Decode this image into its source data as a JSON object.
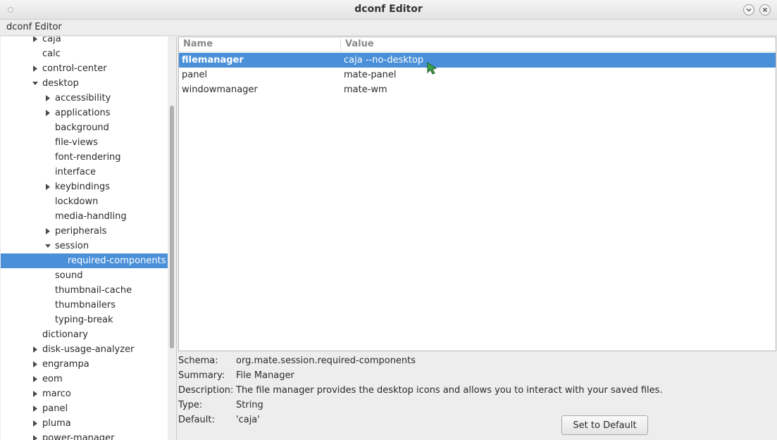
{
  "window": {
    "title": "dconf Editor"
  },
  "menubar": {
    "label": "dconf Editor"
  },
  "tree": {
    "rows": [
      {
        "label": "caja",
        "expander": "collapsed",
        "depth": 0,
        "selected": false
      },
      {
        "label": "calc",
        "expander": "none",
        "depth": 0,
        "selected": false
      },
      {
        "label": "control-center",
        "expander": "collapsed",
        "depth": 0,
        "selected": false
      },
      {
        "label": "desktop",
        "expander": "expanded",
        "depth": 0,
        "selected": false
      },
      {
        "label": "accessibility",
        "expander": "collapsed",
        "depth": 1,
        "selected": false
      },
      {
        "label": "applications",
        "expander": "collapsed",
        "depth": 1,
        "selected": false
      },
      {
        "label": "background",
        "expander": "none",
        "depth": 1,
        "selected": false
      },
      {
        "label": "file-views",
        "expander": "none",
        "depth": 1,
        "selected": false
      },
      {
        "label": "font-rendering",
        "expander": "none",
        "depth": 1,
        "selected": false
      },
      {
        "label": "interface",
        "expander": "none",
        "depth": 1,
        "selected": false
      },
      {
        "label": "keybindings",
        "expander": "collapsed",
        "depth": 1,
        "selected": false
      },
      {
        "label": "lockdown",
        "expander": "none",
        "depth": 1,
        "selected": false
      },
      {
        "label": "media-handling",
        "expander": "none",
        "depth": 1,
        "selected": false
      },
      {
        "label": "peripherals",
        "expander": "collapsed",
        "depth": 1,
        "selected": false
      },
      {
        "label": "session",
        "expander": "expanded",
        "depth": 1,
        "selected": false
      },
      {
        "label": "required-components",
        "expander": "none",
        "depth": 2,
        "selected": true
      },
      {
        "label": "sound",
        "expander": "none",
        "depth": 1,
        "selected": false
      },
      {
        "label": "thumbnail-cache",
        "expander": "none",
        "depth": 1,
        "selected": false
      },
      {
        "label": "thumbnailers",
        "expander": "none",
        "depth": 1,
        "selected": false
      },
      {
        "label": "typing-break",
        "expander": "none",
        "depth": 1,
        "selected": false
      },
      {
        "label": "dictionary",
        "expander": "none",
        "depth": 0,
        "selected": false
      },
      {
        "label": "disk-usage-analyzer",
        "expander": "collapsed",
        "depth": 0,
        "selected": false
      },
      {
        "label": "engrampa",
        "expander": "collapsed",
        "depth": 0,
        "selected": false
      },
      {
        "label": "eom",
        "expander": "collapsed",
        "depth": 0,
        "selected": false
      },
      {
        "label": "marco",
        "expander": "collapsed",
        "depth": 0,
        "selected": false
      },
      {
        "label": "panel",
        "expander": "collapsed",
        "depth": 0,
        "selected": false
      },
      {
        "label": "pluma",
        "expander": "collapsed",
        "depth": 0,
        "selected": false
      },
      {
        "label": "power-manager",
        "expander": "collapsed",
        "depth": 0,
        "selected": false
      }
    ]
  },
  "list": {
    "columns": {
      "name": "Name",
      "value": "Value"
    },
    "rows": [
      {
        "name": "filemanager",
        "value": "caja --no-desktop",
        "selected": true
      },
      {
        "name": "panel",
        "value": "mate-panel",
        "selected": false
      },
      {
        "name": "windowmanager",
        "value": "mate-wm",
        "selected": false
      }
    ]
  },
  "details": {
    "schema_label": "Schema:",
    "schema": "org.mate.session.required-components",
    "summary_label": "Summary:",
    "summary": "File Manager",
    "description_label": "Description:",
    "description": "The file manager provides the desktop icons and allows you to interact with your saved files.",
    "type_label": "Type:",
    "type": "String",
    "default_label": "Default:",
    "default": "'caja'"
  },
  "buttons": {
    "set_default": "Set to Default"
  },
  "icons": {
    "minimize": "chevron-down-icon",
    "close": "close-icon",
    "expander_collapsed": "triangle-right-icon",
    "expander_expanded": "triangle-down-icon",
    "cursor": "pointer-cursor-icon"
  },
  "colors": {
    "selection": "#4a90d9",
    "cursor": "#3fa34d"
  }
}
